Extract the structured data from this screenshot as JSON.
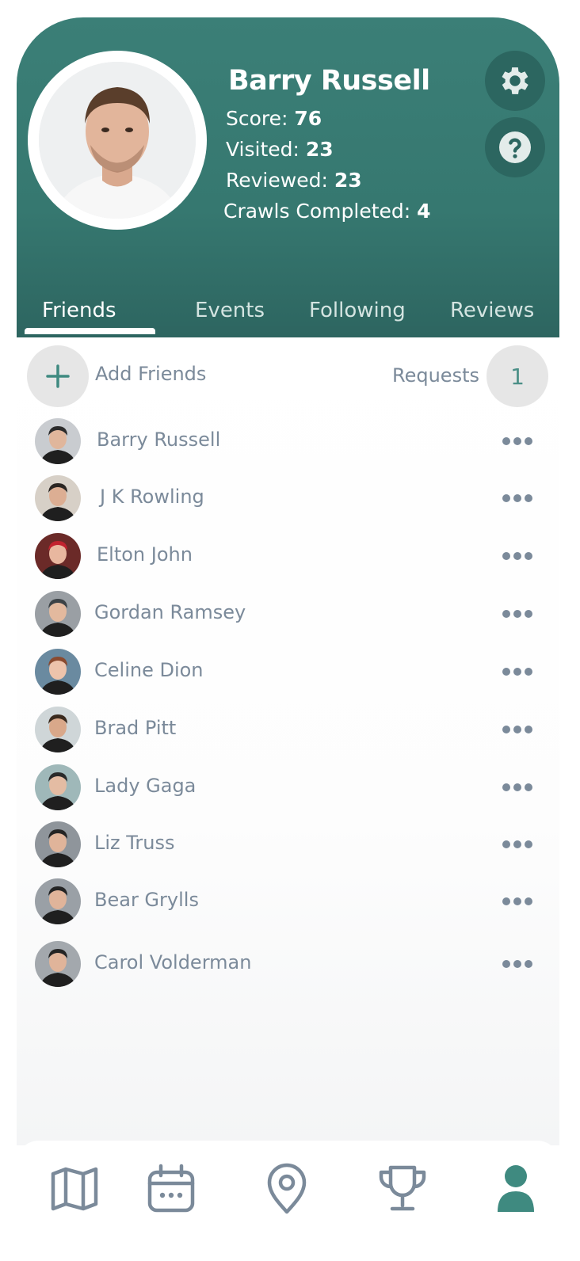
{
  "profile": {
    "name": "Barry Russell",
    "stats": [
      {
        "label": "Score: ",
        "value": "76"
      },
      {
        "label": "Visited: ",
        "value": "23"
      },
      {
        "label": "Reviewed: ",
        "value": "23"
      },
      {
        "label": "Crawls Completed: ",
        "value": "4"
      }
    ]
  },
  "tabs": [
    {
      "label": "Friends",
      "active": true
    },
    {
      "label": "Events",
      "active": false
    },
    {
      "label": "Following",
      "active": false
    },
    {
      "label": "Reviews",
      "active": false
    }
  ],
  "actions": {
    "add_friends": "Add Friends",
    "requests_label": "Requests",
    "requests_count": "1"
  },
  "friends": [
    {
      "name": "Barry Russell"
    },
    {
      "name": "J K Rowling"
    },
    {
      "name": "Elton John"
    },
    {
      "name": "Gordan Ramsey"
    },
    {
      "name": "Celine Dion"
    },
    {
      "name": "Brad Pitt"
    },
    {
      "name": "Lady Gaga"
    },
    {
      "name": "Liz Truss"
    },
    {
      "name": "Bear Grylls"
    },
    {
      "name": "Carol Volderman"
    }
  ],
  "nav": [
    {
      "icon": "map-icon"
    },
    {
      "icon": "calendar-icon"
    },
    {
      "icon": "location-pin-icon"
    },
    {
      "icon": "trophy-icon"
    },
    {
      "icon": "profile-icon",
      "active": true
    }
  ],
  "colors": {
    "header": "#367870",
    "accent": "#3f8a80",
    "text_muted": "#7b8a9a",
    "nav_icon": "#7b8a9a"
  }
}
